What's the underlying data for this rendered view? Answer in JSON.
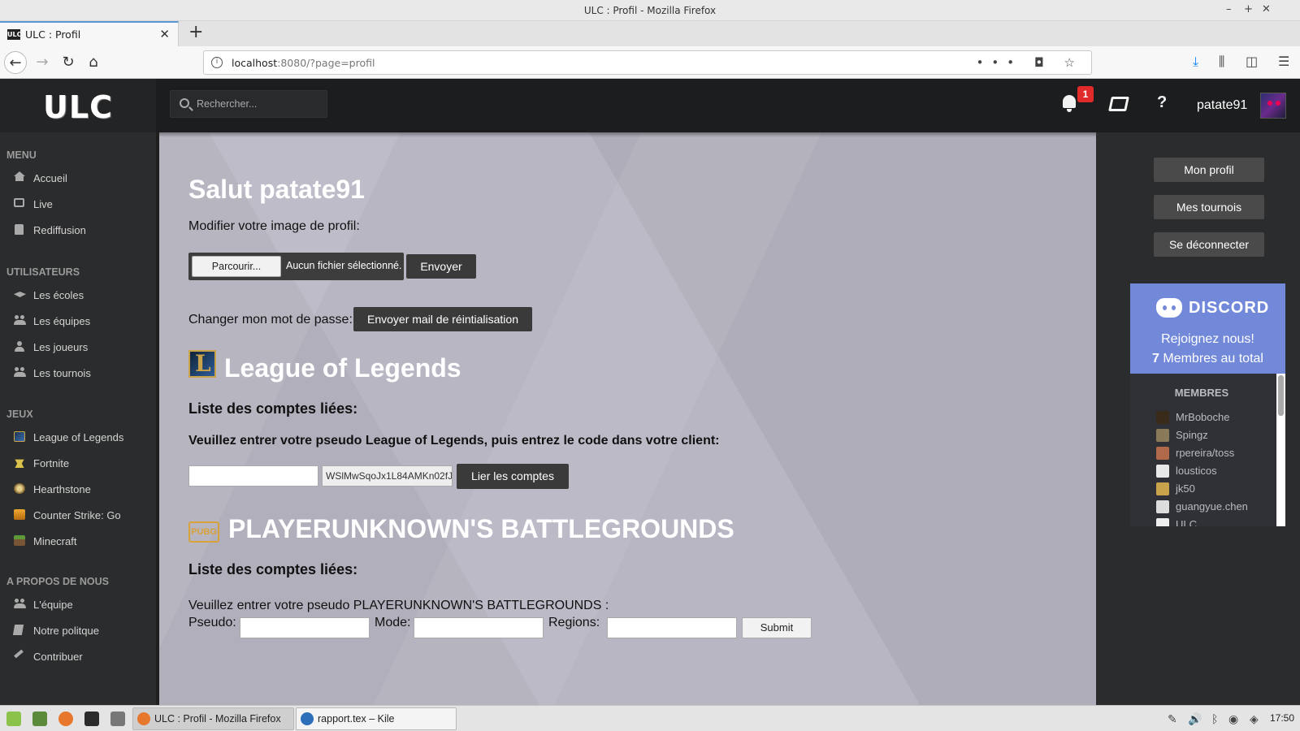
{
  "browser": {
    "window_title": "ULC : Profil - Mozilla Firefox",
    "tab_title": "ULC : Profil",
    "url_host": "localhost",
    "url_rest": ":8080/?page=profil"
  },
  "header": {
    "logo": "ULC",
    "search_placeholder": "Rechercher...",
    "notification_count": "1",
    "help": "?",
    "username": "patate91"
  },
  "sidebar": {
    "sections": [
      {
        "title": "MENU",
        "items": [
          {
            "label": "Accueil",
            "icon": "home-icon"
          },
          {
            "label": "Live",
            "icon": "tv-icon"
          },
          {
            "label": "Rediffusion",
            "icon": "trash-icon"
          }
        ]
      },
      {
        "title": "UTILISATEURS",
        "items": [
          {
            "label": "Les écoles",
            "icon": "graduation-cap-icon"
          },
          {
            "label": "Les équipes",
            "icon": "users-icon"
          },
          {
            "label": "Les joueurs",
            "icon": "user-icon"
          },
          {
            "label": "Les tournois",
            "icon": "users-icon"
          }
        ]
      },
      {
        "title": "JEUX",
        "items": [
          {
            "label": "League of Legends",
            "icon": "lol-icon"
          },
          {
            "label": "Fortnite",
            "icon": "fortnite-icon"
          },
          {
            "label": "Hearthstone",
            "icon": "hearthstone-icon"
          },
          {
            "label": "Counter Strike: Go",
            "icon": "csgo-icon"
          },
          {
            "label": "Minecraft",
            "icon": "minecraft-icon"
          }
        ]
      },
      {
        "title": "A PROPOS DE NOUS",
        "items": [
          {
            "label": "L'équipe",
            "icon": "users-icon"
          },
          {
            "label": "Notre politque",
            "icon": "book-icon"
          },
          {
            "label": "Contribuer",
            "icon": "hammer-icon"
          }
        ]
      }
    ]
  },
  "main": {
    "greeting": "Salut patate91",
    "profile_image_label": "Modifier votre image de profil:",
    "browse_label": "Parcourir...",
    "no_file_label": "Aucun fichier sélectionné.",
    "send_label": "Envoyer",
    "password_label": "Changer mon mot de passe:",
    "reset_mail_label": "Envoyer mail de réintialisation",
    "lol": {
      "title": "League of Legends",
      "linked_title": "Liste des comptes liées:",
      "instructions": "Veuillez entrer votre pseudo League of Legends, puis entrez le code dans votre client:",
      "pseudo_value": "",
      "code": "WSlMwSqoJx1L84AMKn02fJ",
      "link_label": "Lier les comptes"
    },
    "pubg": {
      "logo_text": "PUBG",
      "title": "PLAYERUNKNOWN'S BATTLEGROUNDS",
      "linked_title": "Liste des comptes liées:",
      "instructions": "Veuillez entrer votre pseudo PLAYERUNKNOWN'S BATTLEGROUNDS :",
      "pseudo_label": "Pseudo:",
      "mode_label": "Mode:",
      "regions_label": "Regions:",
      "submit_label": "Submit"
    }
  },
  "right_panel": {
    "buttons": [
      "Mon profil",
      "Mes tournois",
      "Se déconnecter"
    ],
    "discord": {
      "name": "DISCORD",
      "join_text": "Rejoignez nous!",
      "member_count": "7",
      "member_suffix": " Membres au total",
      "members_title": "MEMBRES",
      "members": [
        {
          "name": "MrBoboche",
          "color": "#3a2a1a"
        },
        {
          "name": "Spingz",
          "color": "#8a7a5a"
        },
        {
          "name": "rpereira/toss",
          "color": "#b06a4a"
        },
        {
          "name": "lousticos",
          "color": "#e8e8e8"
        },
        {
          "name": "jk50",
          "color": "#c9a24c"
        },
        {
          "name": "guangyue.chen",
          "color": "#ddd"
        },
        {
          "name": "ULC",
          "color": "#eee"
        }
      ]
    }
  },
  "taskbar": {
    "tasks": [
      "ULC : Profil - Mozilla Firefox",
      "rapport.tex – Kile"
    ],
    "clock": "17:50"
  }
}
